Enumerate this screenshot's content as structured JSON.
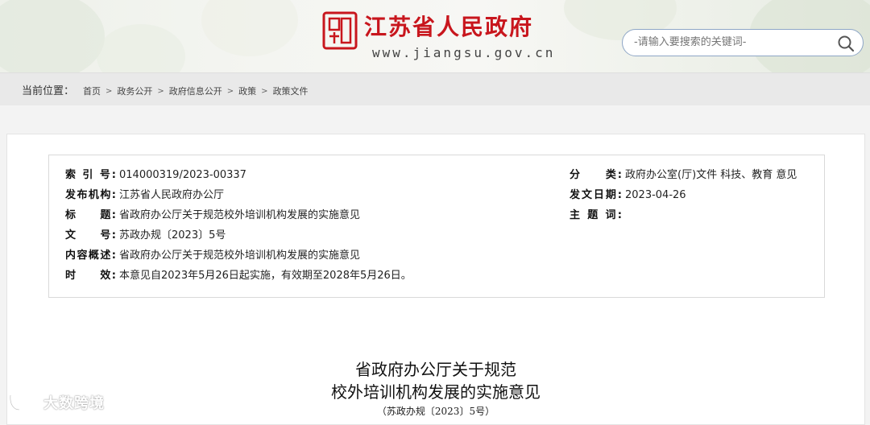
{
  "header": {
    "site_name": "江苏省人民政府",
    "site_url": "www.jiangsu.gov.cn",
    "search_placeholder": "-请输入要搜索的关键词-",
    "colors": {
      "brand": "#c8161d",
      "search_border": "#8ea6c6"
    }
  },
  "breadcrumb": {
    "label": "当前位置：",
    "items": [
      "首页",
      "政务公开",
      "政府信息公开",
      "政策",
      "政策文件"
    ],
    "separator": ">"
  },
  "meta": {
    "index_label": "索 引 号:",
    "index_value": "014000319/2023-00337",
    "publisher_label": "发布机构:",
    "publisher_value": "江苏省人民政府办公厅",
    "title_label": "标　　题:",
    "title_value": "省政府办公厅关于规范校外培训机构发展的实施意见",
    "docno_label": "文　　号:",
    "docno_value": "苏政办规〔2023〕5号",
    "summary_label": "内容概述:",
    "summary_value": "省政府办公厅关于规范校外培训机构发展的实施意见",
    "validity_label": "时　　效:",
    "validity_value": "本意见自2023年5月26日起实施，有效期至2028年5月26日。",
    "category_label": "分　　类:",
    "category_value": "政府办公室(厅)文件 科技、教育 意见",
    "date_label": "发文日期:",
    "date_value": "2023-04-26",
    "subject_label": "主 题 词:",
    "subject_value": ""
  },
  "document": {
    "title_line1": "省政府办公厅关于规范",
    "title_line2": "校外培训机构发展的实施意见",
    "number": "（苏政办规〔2023〕5号）"
  },
  "watermark": {
    "text": "大数跨境"
  }
}
